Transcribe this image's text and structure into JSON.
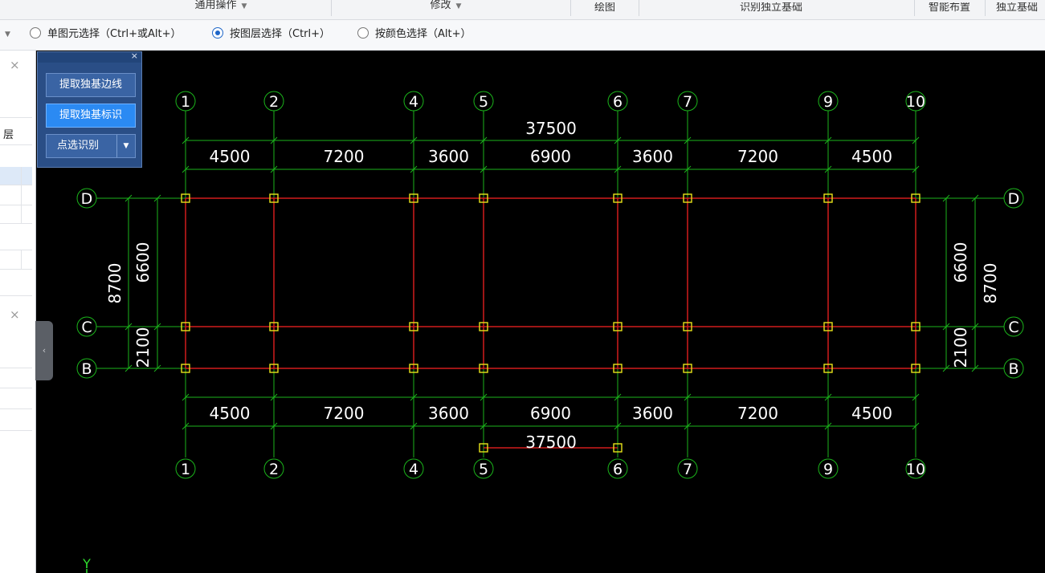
{
  "ribbon": {
    "groups": [
      {
        "label": "通用操作",
        "dropdown": true
      },
      {
        "label": "修改",
        "dropdown": true
      },
      {
        "label": "绘图",
        "dropdown": false
      },
      {
        "label": "识别独立基础",
        "dropdown": false
      },
      {
        "label": "智能布置",
        "dropdown": false
      },
      {
        "label": "独立基础",
        "dropdown": false
      }
    ]
  },
  "selection_bar": {
    "options": [
      {
        "label": "单图元选择（Ctrl+或Alt+）",
        "selected": false
      },
      {
        "label": "按图层选择（Ctrl+）",
        "selected": true
      },
      {
        "label": "按颜色选择（Alt+）",
        "selected": false
      }
    ]
  },
  "left_panel": {
    "text_1": "层",
    "close_glyph": "×"
  },
  "float_panel": {
    "close_glyph": "×",
    "buttons": [
      {
        "label": "提取独基边线",
        "active": false
      },
      {
        "label": "提取独基标识",
        "active": true
      },
      {
        "label": "点选识别",
        "active": false,
        "split": true
      }
    ]
  },
  "drawing": {
    "background": "#000000",
    "colors": {
      "axis": "#1bb51b",
      "beam": "#d11c1c",
      "column": "#e8e31a",
      "text": "#ffffff",
      "ucs": "#2fe02f"
    },
    "axes_x": {
      "labels": [
        "1",
        "2",
        "4",
        "5",
        "6",
        "7",
        "9",
        "10"
      ],
      "spans": [
        "4500",
        "7200",
        "3600",
        "6900",
        "3600",
        "7200",
        "4500"
      ],
      "total": "37500"
    },
    "axes_y": {
      "labels": [
        "D",
        "C",
        "B"
      ],
      "spans": [
        "6600",
        "2100"
      ],
      "total": "8700"
    },
    "bottom_total": "37500",
    "ucs_label": "Y"
  },
  "collapse_glyph": "‹"
}
